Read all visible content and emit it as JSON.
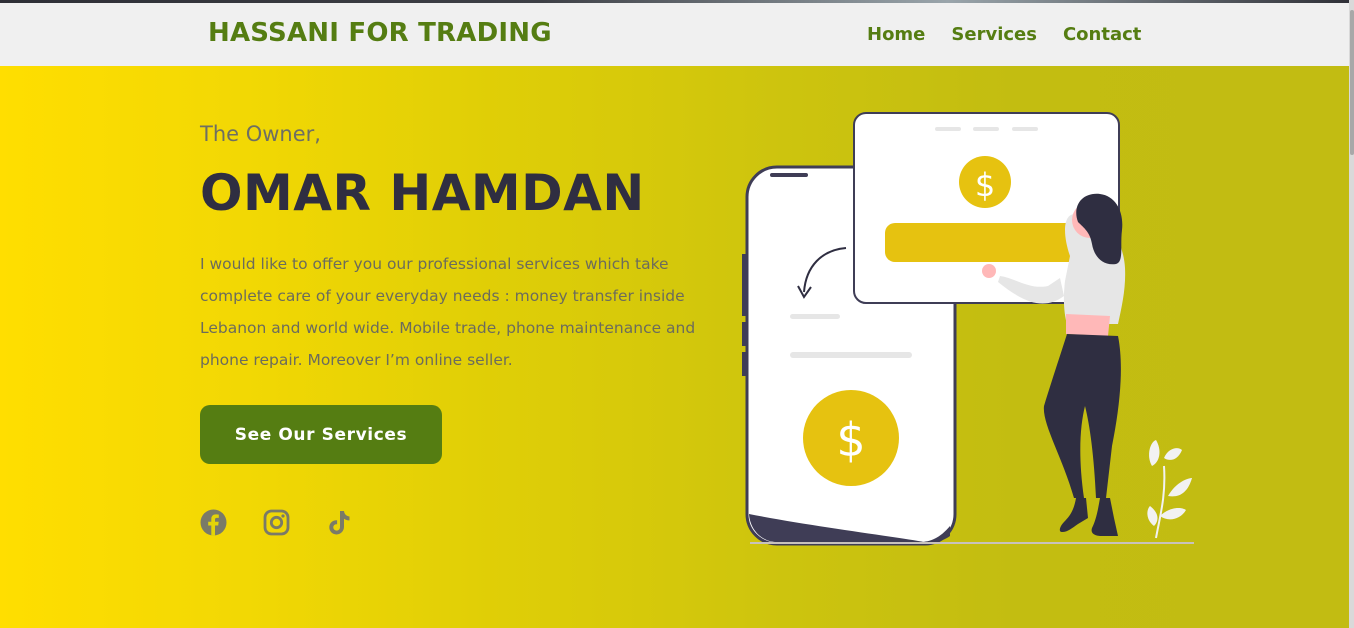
{
  "nav": {
    "brand": "HASSANI FOR TRADING",
    "links": [
      {
        "label": "Home"
      },
      {
        "label": "Services"
      },
      {
        "label": "Contact"
      }
    ]
  },
  "hero": {
    "owner_label": "The Owner,",
    "owner_name": "OMAR HAMDAN",
    "intro": "I would like to offer you our professional services which take complete care of your everyday needs : money transfer inside Lebanon and world wide. Mobile trade, phone maintenance and phone repair. Moreover I’m online seller.",
    "cta_label": "See Our Services",
    "socials": [
      "facebook-icon",
      "instagram-icon",
      "tiktok-icon"
    ],
    "illustration": {
      "coin_symbol_large": "$",
      "coin_symbol_small": "$"
    }
  },
  "colors": {
    "brand_green": "#557d12",
    "hero_start": "#ffde00",
    "hero_end": "#c2bc12",
    "dark": "#2f2e41",
    "coin": "#e6c210"
  }
}
